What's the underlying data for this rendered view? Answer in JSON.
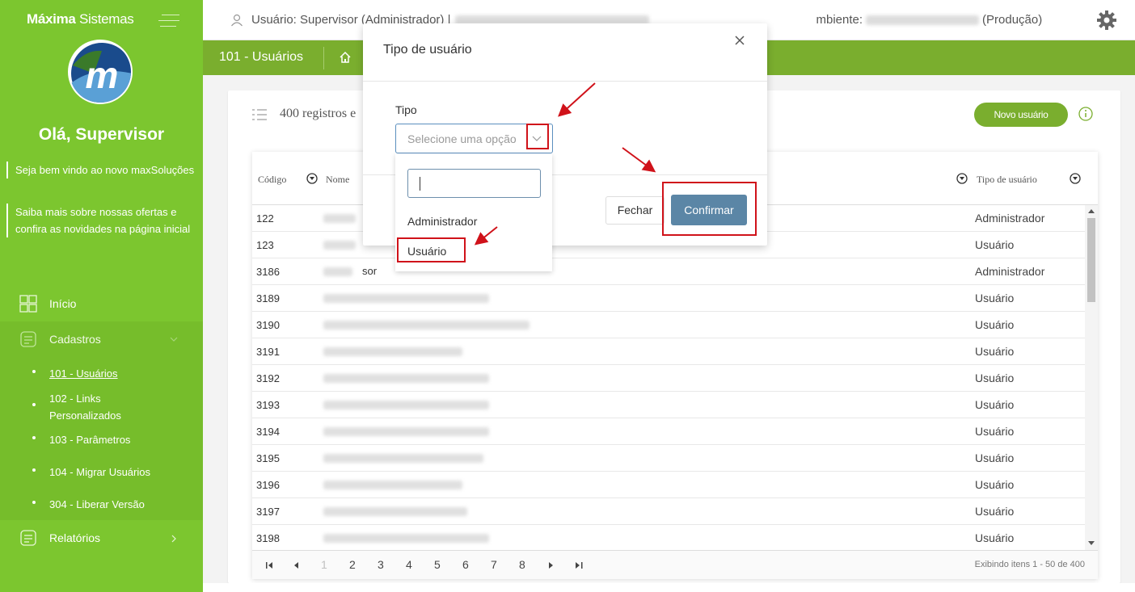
{
  "brand": {
    "bold": "Máxima",
    "rest": " Sistemas"
  },
  "sidebar": {
    "greeting": "Olá, Supervisor",
    "info": [
      "Seja bem vindo ao novo maxSoluções",
      "Saiba mais sobre nossas ofertas e confira as novidades na página inicial"
    ],
    "nav": {
      "inicio": "Início",
      "cadastros": "Cadastros",
      "relatorios": "Relatórios"
    },
    "submenu": [
      "101 - Usuários",
      "102 - Links Personalizados",
      "103 - Parâmetros",
      "104 - Migrar Usuários",
      "304 - Liberar Versão"
    ]
  },
  "header": {
    "user_label": "Usuário: Supervisor (Administrador) |",
    "ambiente_label": "mbiente:",
    "env": "(Produção)"
  },
  "breadcrumb": {
    "title": "101 - Usuários"
  },
  "page": {
    "records": "400 registros e",
    "new_user": "Novo usuário"
  },
  "table": {
    "columns": {
      "codigo": "Código",
      "nome": "Nome",
      "tipo": "Tipo de usuário"
    },
    "rows": [
      {
        "codigo": "122",
        "nome": "",
        "tipo": "Administrador"
      },
      {
        "codigo": "123",
        "nome": "",
        "tipo": "Usuário"
      },
      {
        "codigo": "3186",
        "nome": "sor",
        "tipo": "Administrador"
      },
      {
        "codigo": "3189",
        "nome": "",
        "tipo": "Usuário"
      },
      {
        "codigo": "3190",
        "nome": "",
        "tipo": "Usuário"
      },
      {
        "codigo": "3191",
        "nome": "",
        "tipo": "Usuário"
      },
      {
        "codigo": "3192",
        "nome": "",
        "tipo": "Usuário"
      },
      {
        "codigo": "3193",
        "nome": "",
        "tipo": "Usuário"
      },
      {
        "codigo": "3194",
        "nome": "",
        "tipo": "Usuário"
      },
      {
        "codigo": "3195",
        "nome": "",
        "tipo": "Usuário"
      },
      {
        "codigo": "3196",
        "nome": "",
        "tipo": "Usuário"
      },
      {
        "codigo": "3197",
        "nome": "",
        "tipo": "Usuário"
      },
      {
        "codigo": "3198",
        "nome": "",
        "tipo": "Usuário"
      }
    ],
    "pages": [
      "1",
      "2",
      "3",
      "4",
      "5",
      "6",
      "7",
      "8"
    ],
    "pager_info": "Exibindo itens 1 - 50 de 400"
  },
  "modal": {
    "title": "Tipo de usuário",
    "field_label": "Tipo",
    "placeholder": "Selecione uma opção",
    "close_label": "Fechar",
    "confirm_label": "Confirmar",
    "options": [
      "Administrador",
      "Usuário"
    ]
  },
  "colors": {
    "sidebar": "#7cc62f",
    "breadcrumb": "#7aae2e",
    "confirm": "#5b86a6",
    "annotation": "#d0121a"
  }
}
